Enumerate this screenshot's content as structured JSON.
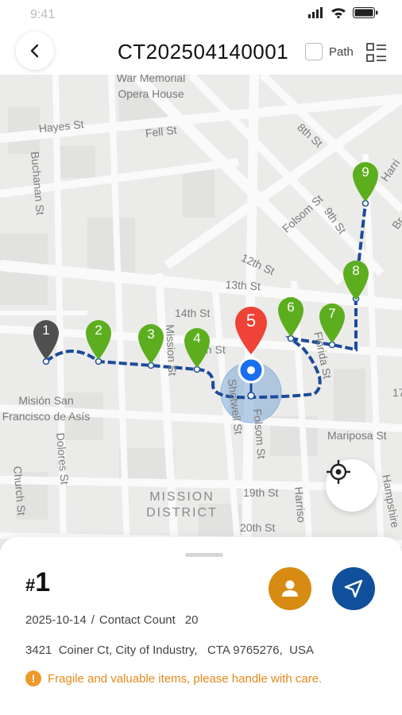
{
  "status_bar": {
    "time": "9:41"
  },
  "header": {
    "order_id": "CT202504140001",
    "path_label": "Path",
    "path_checked": false
  },
  "map": {
    "streets": [
      "War Memorial Opera House",
      "Hayes St",
      "Fell St",
      "Buchanan St",
      "8th St",
      "Folsom St",
      "9th St",
      "Harri",
      "Br",
      "12th St",
      "13th St",
      "14th St",
      "th St",
      "Mission St",
      "Shotwell St",
      "Folsom St",
      "Florida St",
      "Mariposa St",
      "Dolores St",
      "Church St",
      "19th St",
      "20th St",
      "Harriso",
      "Hampshire",
      "17"
    ],
    "poi": "Misión San Francisco de Asís",
    "district": "MISSION DISTRICT",
    "stops": [
      {
        "label": "1",
        "status": "done"
      },
      {
        "label": "2",
        "status": "pending"
      },
      {
        "label": "3",
        "status": "pending"
      },
      {
        "label": "4",
        "status": "pending"
      },
      {
        "label": "5",
        "status": "current"
      },
      {
        "label": "6",
        "status": "pending"
      },
      {
        "label": "7",
        "status": "pending"
      },
      {
        "label": "8",
        "status": "pending"
      },
      {
        "label": "9",
        "status": "pending"
      }
    ],
    "colors": {
      "done": "#505050",
      "pending": "#5cae1e",
      "current": "#ee4336",
      "route": "#1d4b9a",
      "you": "#1a6ef0"
    }
  },
  "sheet": {
    "hash": "#",
    "stop_number": "1",
    "date": "2025-10-14",
    "separator": "/",
    "contact_count_label": "Contact Count",
    "contact_count": "20",
    "address": "3421  Coiner Ct, City of Industry,   CTA 9765276,  USA",
    "notice_icon": "!",
    "notice": "Fragile and valuable items, please handle with care."
  }
}
